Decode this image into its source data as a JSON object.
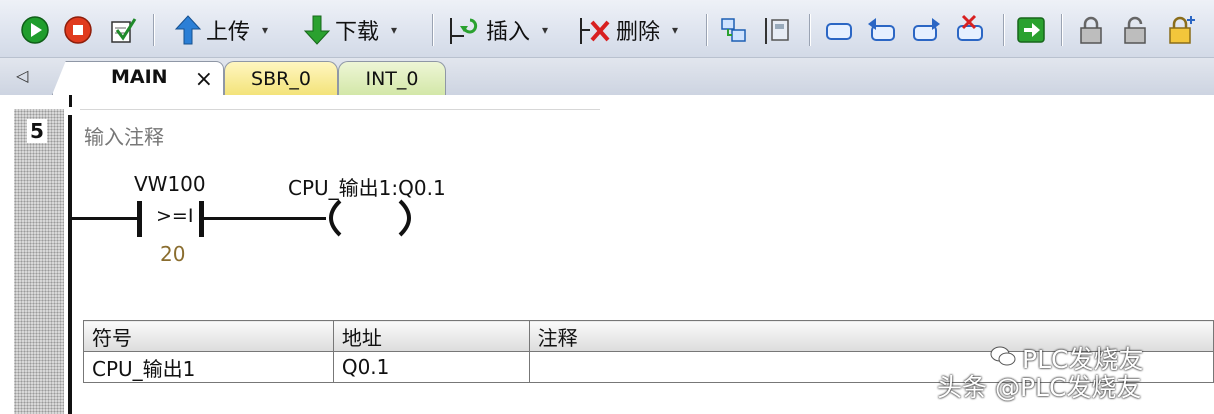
{
  "toolbar": {
    "upload_label": "上传",
    "download_label": "下载",
    "insert_label": "插入",
    "delete_label": "删除",
    "dropdown_arrow": "▾"
  },
  "tabs": {
    "scroll_left": "◁",
    "main": "MAIN",
    "main_close": "×",
    "sbr": "SBR_0",
    "int": "INT_0"
  },
  "rung": {
    "number": "5",
    "comment": "输入注释",
    "contact_operand": "VW100",
    "contact_compare": ">=I",
    "contact_value": "20",
    "coil_operand": "CPU_输出1:Q0.1"
  },
  "symbol_table": {
    "headers": [
      "符号",
      "地址",
      "注释"
    ],
    "rows": [
      [
        "CPU_输出1",
        "Q0.1",
        ""
      ]
    ]
  },
  "watermark": {
    "line1": "PLC发烧友",
    "line2": "头条 @PLC发烧友"
  },
  "colors": {
    "run_green": "#1f9d2c",
    "stop_red": "#e03a1e",
    "arrow_blue": "#2b7fd6",
    "arrow_green": "#2aa12f",
    "contact_value": "#8a6d2f"
  }
}
